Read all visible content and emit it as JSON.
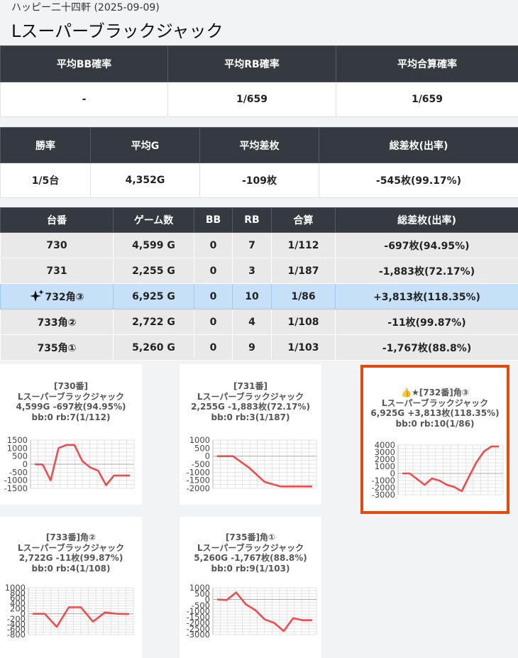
{
  "header": {
    "subtitle": "ハッピー二十四軒 (2025-09-09)",
    "title": "Lスーパーブラックジャック"
  },
  "summary1": {
    "headers": [
      "平均BB確率",
      "平均RB確率",
      "平均合算確率"
    ],
    "values": [
      "-",
      "1/659",
      "1/659"
    ]
  },
  "summary2": {
    "headers": [
      "勝率",
      "平均G",
      "平均差枚",
      "総差枚(出率)"
    ],
    "values": [
      "1/5台",
      "4,352G",
      "-109枚",
      "-545枚(99.17%)"
    ]
  },
  "machines": {
    "headers": [
      "台番",
      "ゲーム数",
      "BB",
      "RB",
      "合算",
      "総差枚(出率)"
    ],
    "highlight_icon": "sparkles-icon",
    "rows": [
      {
        "id": "730",
        "games": "4,599 G",
        "bb": "0",
        "rb": "7",
        "total": "1/112",
        "diff": "-697枚(94.95%)",
        "highlight": false
      },
      {
        "id": "731",
        "games": "2,255 G",
        "bb": "0",
        "rb": "3",
        "total": "1/187",
        "diff": "-1,883枚(72.17%)",
        "highlight": false
      },
      {
        "id": "732角③",
        "games": "6,925 G",
        "bb": "0",
        "rb": "10",
        "total": "1/86",
        "diff": "+3,813枚(118.35%)",
        "highlight": true
      },
      {
        "id": "733角②",
        "games": "2,722 G",
        "bb": "0",
        "rb": "4",
        "total": "1/108",
        "diff": "-11枚(99.87%)",
        "highlight": false
      },
      {
        "id": "735角①",
        "games": "5,260 G",
        "bb": "0",
        "rb": "9",
        "total": "1/103",
        "diff": "-1,767枚(88.8%)",
        "highlight": false
      }
    ]
  },
  "colors": {
    "line": "#f24b4b",
    "highlight_border": "#e34a0e",
    "header_bg": "#343a40",
    "row_highlight": "#c6e1f7"
  },
  "chart_data": [
    {
      "type": "line",
      "lines": [
        "[730番]",
        "Lスーパーブラックジャック",
        "4,599G -697枚(94.95%)",
        "bb:0 rb:7(1/112)"
      ],
      "yticks": [
        1500,
        1000,
        500,
        0,
        -500,
        -1000,
        -1500
      ],
      "ylim": [
        -1500,
        1500
      ],
      "values": [
        0,
        -20,
        -1000,
        1000,
        1200,
        1200,
        200,
        -200,
        -400,
        -1300,
        -700,
        -700,
        -700
      ]
    },
    {
      "type": "line",
      "lines": [
        "[731番]",
        "Lスーパーブラックジャック",
        "2,255G -1,883枚(72.17%)",
        "bb:0 rb:3(1/187)"
      ],
      "yticks": [
        1000,
        500,
        0,
        -500,
        -1000,
        -1500,
        -2000
      ],
      "ylim": [
        -2000,
        1000
      ],
      "values": [
        0,
        0,
        -700,
        -1600,
        -1880,
        -1880,
        -1880
      ]
    },
    {
      "type": "line",
      "lines": [
        "👍★[732番]角③",
        "Lスーパーブラックジャック",
        "6,925G +3,813枚(118.35%)",
        "bb:0 rb:10(1/86)"
      ],
      "yticks": [
        4000,
        3000,
        2000,
        1000,
        0,
        -1000,
        -2000,
        -3000
      ],
      "ylim": [
        -3000,
        4000
      ],
      "values": [
        0,
        0,
        -800,
        -1600,
        -700,
        -1000,
        -1600,
        -1900,
        -2500,
        -400,
        1600,
        3100,
        3800,
        3800
      ]
    },
    {
      "type": "line",
      "lines": [
        "[733番]角②",
        "Lスーパーブラックジャック",
        "2,722G -11枚(99.87%)",
        "bb:0 rb:4(1/108)"
      ],
      "yticks": [
        1000,
        800,
        600,
        400,
        200,
        0,
        -200,
        -400,
        -600,
        -800
      ],
      "ylim": [
        -800,
        1000
      ],
      "values": [
        0,
        0,
        -500,
        250,
        250,
        -300,
        50,
        0,
        -10
      ]
    },
    {
      "type": "line",
      "lines": [
        "[735番]角①",
        "Lスーパーブラックジャック",
        "5,260G -1,767枚(88.8%)",
        "bb:0 rb:9(1/103)"
      ],
      "yticks": [
        1000,
        500,
        0,
        -500,
        -1000,
        -1500,
        -2000,
        -2500,
        -3000
      ],
      "ylim": [
        -3000,
        1000
      ],
      "values": [
        0,
        -50,
        600,
        -400,
        -900,
        -1700,
        -2000,
        -2700,
        -1600,
        -1770,
        -1770
      ]
    }
  ]
}
